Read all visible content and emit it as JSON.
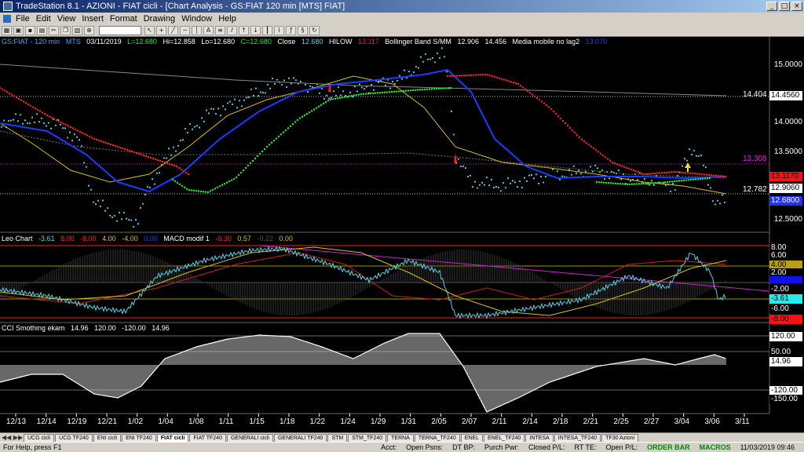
{
  "window": {
    "title": "TradeStation 8.1 - AZIONI - FIAT cicli - [Chart Analysis - GS:FIAT  120 min  [MTS] FIAT]"
  },
  "menu": [
    "File",
    "Edit",
    "View",
    "Insert",
    "Format",
    "Drawing",
    "Window",
    "Help"
  ],
  "chart_header": {
    "symbol": "GS:FIAT - 120 min",
    "exchange": "MTS",
    "date": "03/11/2019",
    "low_label": "L=12.680",
    "hi": "Hi=12.858",
    "lo": "Lo=12.680",
    "close_label": "C=12.680",
    "close_word": "Close",
    "close_val": "12.680",
    "hilow": "HILOW",
    "hilow_val": "13.117",
    "bb_name": "Bollinger Band S/MM",
    "bb_val1": "12.906",
    "bb_val2": "14.456",
    "ma_name": "Media mobile no lag2",
    "ma_val": "13.070"
  },
  "price_scale": {
    "ticks": [
      "15.0000",
      "14.5000",
      "14.0000",
      "13.5000",
      "13.0000",
      "12.5000"
    ],
    "marker_14404": "14.404",
    "marker_13308": "13.308",
    "marker_12782": "12.782",
    "box_14456": "14.4560",
    "box_13117": "13.1170",
    "box_12906": "12.9060",
    "box_12680": "12.6800"
  },
  "leo_panel": {
    "name": "Leo Chart",
    "v1": "-3.61",
    "v2": "8.00",
    "v3": "-8.00",
    "v4": "4.00",
    "v5": "-4.00",
    "v6": "0.00",
    "macd_name": "MACD modif 1",
    "m1": "-0.30",
    "m2": "0.57",
    "m3": "-0.22",
    "m4": "0.00",
    "scale": [
      "8.00",
      "6.00",
      "4.00",
      "2.00",
      "-2.00",
      "-3.61",
      "-6.00",
      "-8.00"
    ]
  },
  "cci_panel": {
    "name": "CCI Smothing ekam",
    "v1": "14.96",
    "v2": "120.00",
    "v3": "-120.00",
    "v4": "14.96",
    "scale": [
      "120.00",
      "50.00",
      "14.96",
      "-120.00",
      "-150.00"
    ]
  },
  "x_axis": [
    "12/13",
    "12/14",
    "12/19",
    "12/21",
    "1/02",
    "1/04",
    "1/08",
    "1/11",
    "1/15",
    "1/18",
    "1/22",
    "1/24",
    "1/29",
    "1/31",
    "2/05",
    "2/07",
    "2/11",
    "2/14",
    "2/18",
    "2/21",
    "2/25",
    "2/27",
    "3/04",
    "3/06",
    "3/11"
  ],
  "tabs": [
    "UCG cicli",
    "UCG TF240",
    "ENI cicli",
    "ENI TF240",
    "FIAT cicli",
    "FIAT TF240",
    "GENERALI cicli",
    "GENERALI TF240",
    "STM",
    "STM_TF240",
    "TERNA",
    "TERNA_TF240",
    "ENEL",
    "ENEL_TF240",
    "INTESA",
    "INTESA_TF240",
    "TF30 Azioni"
  ],
  "active_tab": "FIAT cicli",
  "status": {
    "help": "For Help, press F1",
    "acct": "Acct:",
    "open_psns": "Open Psns:",
    "dt_bp": "DT BP:",
    "purch_pwr": "Purch Pwr:",
    "closed_pl": "Closed P/L:",
    "rt_te": "RT TE:",
    "open_pl": "Open P/L:",
    "order_bar": "ORDER BAR",
    "macros": "MACROS",
    "datetime": "11/03/2019 09:46"
  },
  "colors": {
    "price": "#55d4e8",
    "bb_upper": "#ff2020",
    "bb_lower": "#22ee22",
    "ma": "#1a3cff",
    "yellow": "#d8c020",
    "magenta": "#cc22cc",
    "grey": "#9a9a9a"
  }
}
